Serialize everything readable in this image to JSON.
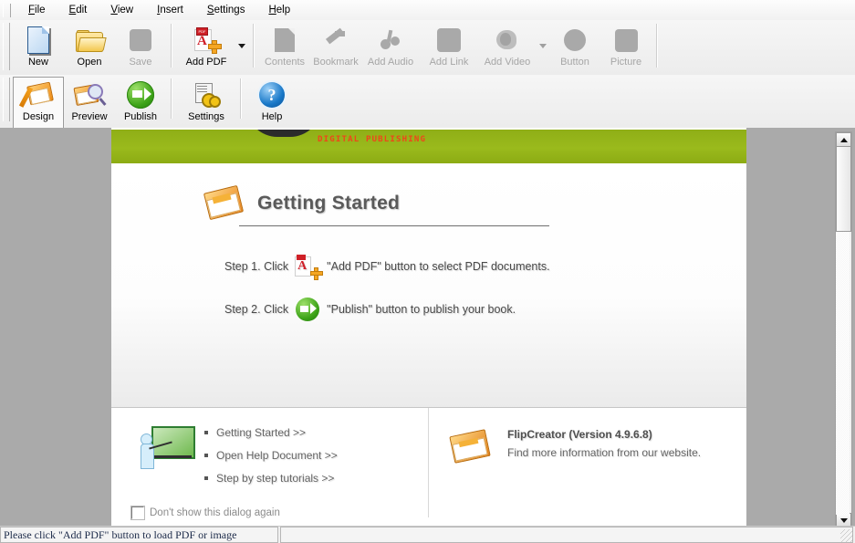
{
  "menubar": {
    "items": [
      {
        "label": "File",
        "accel": "F"
      },
      {
        "label": "Edit",
        "accel": "E"
      },
      {
        "label": "View",
        "accel": "V"
      },
      {
        "label": "Insert",
        "accel": "I"
      },
      {
        "label": "Settings",
        "accel": "S"
      },
      {
        "label": "Help",
        "accel": "H"
      }
    ]
  },
  "toolbar_main": {
    "buttons": [
      {
        "label": "New",
        "icon": "new-document-icon",
        "enabled": true
      },
      {
        "label": "Open",
        "icon": "open-folder-icon",
        "enabled": true
      },
      {
        "label": "Save",
        "icon": "save-icon",
        "enabled": false
      },
      {
        "label": "Add PDF",
        "icon": "add-pdf-icon",
        "enabled": true,
        "dropdown": true
      },
      {
        "label": "Contents",
        "icon": "contents-icon",
        "enabled": false
      },
      {
        "label": "Bookmark",
        "icon": "bookmark-icon",
        "enabled": false
      },
      {
        "label": "Add Audio",
        "icon": "add-audio-icon",
        "enabled": false
      },
      {
        "label": "Add Link",
        "icon": "add-link-icon",
        "enabled": false
      },
      {
        "label": "Add Video",
        "icon": "add-video-icon",
        "enabled": false,
        "dropdown": true
      },
      {
        "label": "Button",
        "icon": "button-icon",
        "enabled": false
      },
      {
        "label": "Picture",
        "icon": "picture-icon",
        "enabled": false
      }
    ]
  },
  "toolbar_mode": {
    "buttons": [
      {
        "label": "Design",
        "icon": "design-icon",
        "selected": true
      },
      {
        "label": "Preview",
        "icon": "preview-icon",
        "selected": false
      },
      {
        "label": "Publish",
        "icon": "publish-icon",
        "selected": false
      },
      {
        "label": "Settings",
        "icon": "settings-icon",
        "selected": false
      },
      {
        "label": "Help",
        "icon": "help-icon",
        "selected": false
      }
    ]
  },
  "dialog": {
    "banner_text": "DIGITAL PUBLISHING",
    "banner_color": "#9aba1c",
    "banner_text_color": "#f0451a",
    "heading": "Getting Started",
    "steps": [
      {
        "prefix": "Step 1. Click",
        "icon": "add-pdf-icon",
        "suffix": "\"Add PDF\" button to select PDF documents."
      },
      {
        "prefix": "Step 2. Click",
        "icon": "publish-icon",
        "suffix": "\"Publish\" button to publish your book."
      }
    ],
    "links": [
      {
        "label": "Getting Started >>"
      },
      {
        "label": "Open Help Document >>"
      },
      {
        "label": "Step by step tutorials >>"
      }
    ],
    "product": {
      "name": "FlipCreator (Version 4.9.6.8)",
      "description": "Find more information from our website."
    },
    "checkbox": {
      "label": "Don't show this dialog again",
      "checked": false
    }
  },
  "statusbar": {
    "message": "Please click \"Add PDF\" button to load PDF or image",
    "secondary": ""
  },
  "scrollbar": {
    "up": "▲",
    "down": "▼"
  }
}
